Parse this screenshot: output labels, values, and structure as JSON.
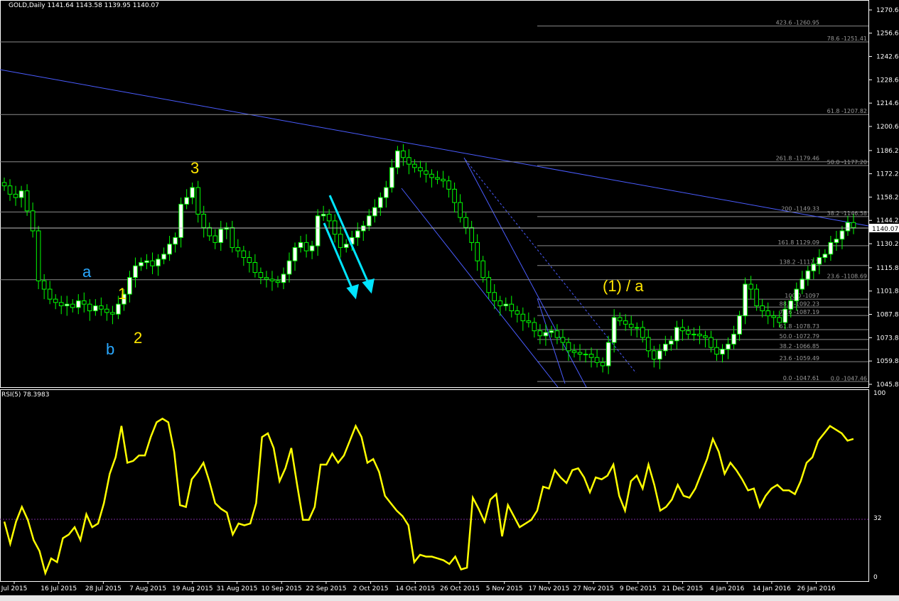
{
  "symbol_header": "GOLD,Daily  1141.64 1143.58 1139.95 1140.07",
  "rsi_header": "RSI(5) 78.3983",
  "current_price": "1140.07",
  "colors": {
    "background": "#000000",
    "candle_up": "#ffffff",
    "candle_wick": "#00ff00",
    "rsi": "#ffff00",
    "trendline": "#4a5cff",
    "arrows": "#00e5ff",
    "fib": "#8a8a8a",
    "wave_yellow": "#ffe600",
    "wave_blue": "#29a8ff"
  },
  "price_axis_labels": [
    "1270.60",
    "1256.68",
    "1242.68",
    "1228.68",
    "1214.68",
    "1200.68",
    "1186.21",
    "1172.28",
    "1158.28",
    "1144.28",
    "1130.28",
    "1115.88",
    "1101.88",
    "1087.88",
    "1073.88",
    "1059.88",
    "1045.88"
  ],
  "rsi_axis_labels": [
    "100",
    "32",
    "0"
  ],
  "time_axis_labels": [
    "Jul 2015",
    "16 Jul 2015",
    "28 Jul 2015",
    "7 Aug 2015",
    "19 Aug 2015",
    "31 Aug 2015",
    "10 Sep 2015",
    "22 Sep 2015",
    "2 Oct 2015",
    "14 Oct 2015",
    "26 Oct 2015",
    "5 Nov 2015",
    "17 Nov 2015",
    "27 Nov 2015",
    "9 Dec 2015",
    "21 Dec 2015",
    "4 Jan 2016",
    "14 Jan 2016",
    "26 Jan 2016"
  ],
  "fib_labels": [
    "423.6 -1260.95",
    "78.6 -1251.41",
    "61.8 -1207.82",
    "261.8 -1179.46",
    "50.0 -1177.20",
    "200 -1149.33",
    "38.2 -1146.58",
    "161.8 1129.09",
    "138.2 -1117.2",
    "23.6 -1108.69",
    "100.0 -1097",
    "88.6 -1092.23",
    "78.6 -1087.19",
    "61.8 -1078.73",
    "50.0 -1072.79",
    "38.2 -1066.85",
    "23.6 -1059.49",
    "0.0 -1047.61",
    "0.0 -1047.46"
  ],
  "wave_labels": [
    "3",
    "1",
    "2",
    "a",
    "b",
    "(1) / a"
  ],
  "chart_data": [
    {
      "type": "candlestick",
      "title": "GOLD,Daily",
      "ylim": [
        1045.88,
        1270.6
      ],
      "close_series": [
        1165,
        1160,
        1158,
        1162,
        1150,
        1138,
        1108,
        1103,
        1097,
        1095,
        1093,
        1094,
        1092,
        1096,
        1094,
        1090,
        1093,
        1091,
        1089,
        1088,
        1094,
        1100,
        1110,
        1117,
        1119,
        1120,
        1117,
        1121,
        1124,
        1130,
        1134,
        1154,
        1158,
        1164,
        1148,
        1140,
        1135,
        1131,
        1139,
        1140,
        1128,
        1126,
        1122,
        1119,
        1113,
        1110,
        1109,
        1108,
        1107,
        1112,
        1120,
        1128,
        1131,
        1126,
        1129,
        1147,
        1148,
        1144,
        1136,
        1128,
        1130,
        1134,
        1138,
        1141,
        1147,
        1152,
        1158,
        1164,
        1176,
        1186,
        1182,
        1178,
        1176,
        1174,
        1172,
        1170,
        1169,
        1168,
        1163,
        1155,
        1146,
        1140,
        1131,
        1120,
        1110,
        1101,
        1096,
        1093,
        1094,
        1090,
        1088,
        1084,
        1083,
        1078,
        1075,
        1077,
        1078,
        1074,
        1071,
        1066,
        1065,
        1064,
        1064,
        1062,
        1059,
        1057,
        1071,
        1086,
        1084,
        1082,
        1080,
        1080,
        1074,
        1066,
        1061,
        1066,
        1070,
        1072,
        1080,
        1078,
        1076,
        1076,
        1075,
        1074,
        1068,
        1064,
        1067,
        1070,
        1076,
        1087,
        1106,
        1103,
        1093,
        1090,
        1087,
        1086,
        1083,
        1091,
        1096,
        1103,
        1109,
        1114,
        1118,
        1122,
        1124,
        1131,
        1133,
        1138,
        1143,
        1140
      ]
    },
    {
      "type": "line",
      "title": "RSI(5) 78.3983",
      "ylim": [
        0,
        100
      ],
      "levels": [
        32
      ],
      "values": [
        30,
        18,
        30,
        38,
        31,
        20,
        14,
        2,
        10,
        8,
        21,
        23,
        27,
        20,
        34,
        27,
        29,
        40,
        56,
        65,
        82,
        62,
        63,
        66,
        66,
        76,
        84,
        86,
        84,
        68,
        39,
        38,
        53,
        57,
        62,
        52,
        40,
        37,
        35,
        23,
        29,
        28,
        29,
        40,
        76,
        78,
        70,
        52,
        59,
        70,
        50,
        31,
        31,
        38,
        61,
        61,
        67,
        62,
        66,
        74,
        82,
        76,
        62,
        64,
        57,
        44,
        40,
        36,
        33,
        28,
        8,
        12,
        11,
        11,
        10,
        9,
        7,
        11,
        4,
        5,
        43,
        37,
        30,
        42,
        45,
        22,
        39,
        33,
        27,
        29,
        31,
        36,
        49,
        48,
        58,
        54,
        51,
        58,
        59,
        54,
        46,
        54,
        53,
        55,
        61,
        44,
        36,
        52,
        55,
        48,
        61,
        50,
        36,
        38,
        42,
        50,
        44,
        43,
        48,
        56,
        64,
        75,
        68,
        56,
        62,
        58,
        53,
        47,
        48,
        38,
        44,
        48,
        50,
        47,
        47,
        45,
        52,
        62,
        65,
        74,
        78,
        82,
        80,
        78,
        74,
        75
      ]
    }
  ]
}
